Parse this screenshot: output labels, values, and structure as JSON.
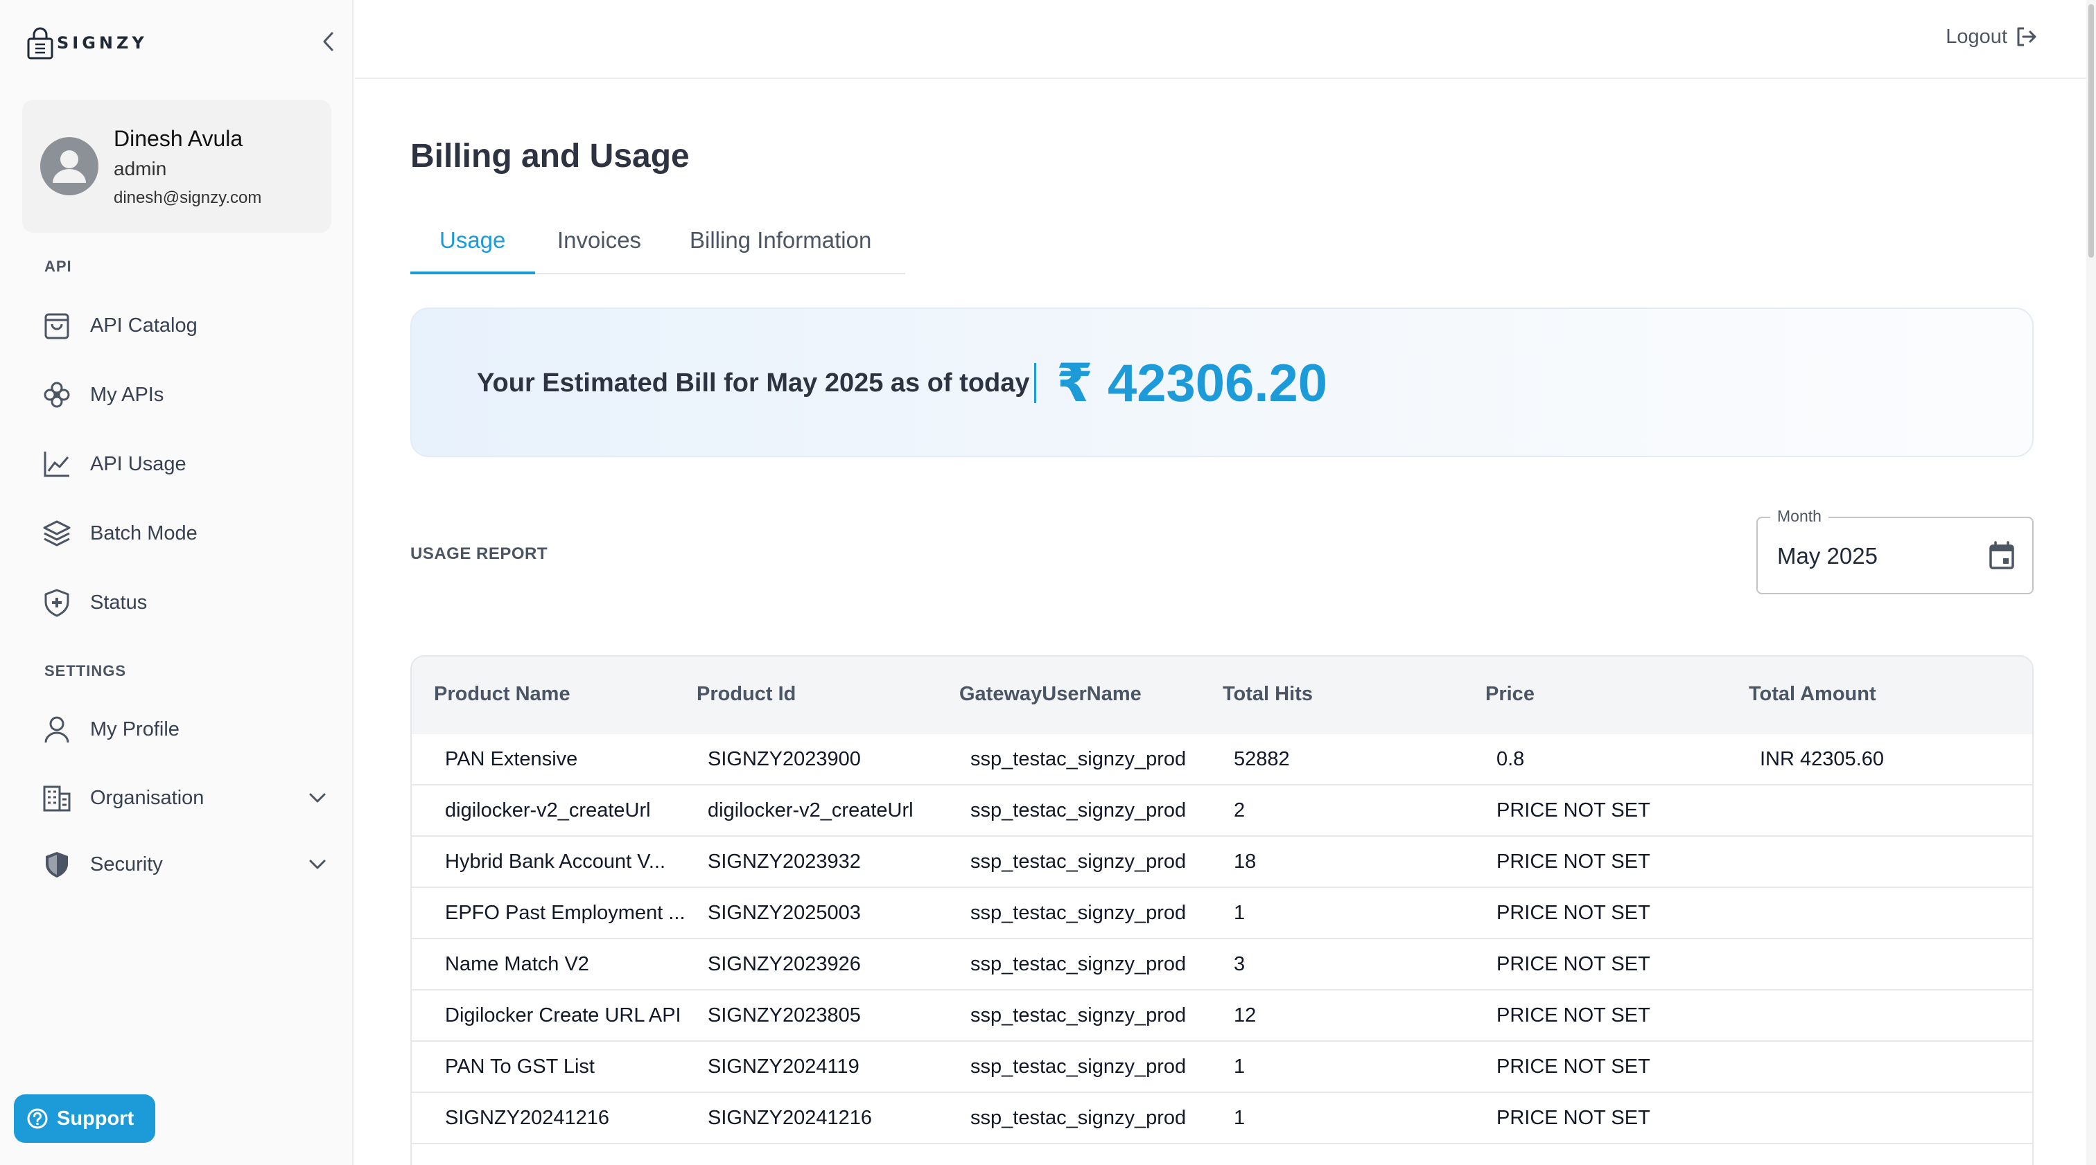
{
  "brand": {
    "logo_text": "SIGNZY"
  },
  "user": {
    "name": "Dinesh Avula",
    "role": "admin",
    "email": "dinesh@signzy.com"
  },
  "sidebar": {
    "api_section_label": "API",
    "api_items": [
      {
        "label": "API Catalog",
        "icon": "shopping-bag-icon"
      },
      {
        "label": "My APIs",
        "icon": "api-nodes-icon"
      },
      {
        "label": "API Usage",
        "icon": "line-chart-icon"
      },
      {
        "label": "Batch Mode",
        "icon": "layers-icon"
      },
      {
        "label": "Status",
        "icon": "shield-plus-icon"
      }
    ],
    "settings_section_label": "SETTINGS",
    "settings_items": [
      {
        "label": "My Profile",
        "icon": "user-icon"
      },
      {
        "label": "Organisation",
        "icon": "building-icon"
      },
      {
        "label": "Security",
        "icon": "shield-icon"
      }
    ],
    "support_label": "Support"
  },
  "topbar": {
    "logout_label": "Logout"
  },
  "main": {
    "title": "Billing and Usage",
    "tabs": [
      {
        "label": "Usage",
        "active": true
      },
      {
        "label": "Invoices",
        "active": false
      },
      {
        "label": "Billing Information",
        "active": false
      }
    ],
    "bill": {
      "text": "Your Estimated Bill for May 2025 as of today",
      "amount": "₹ 42306.20"
    },
    "usage_report_label": "USAGE REPORT",
    "month_picker": {
      "label": "Month",
      "value": "May 2025"
    }
  },
  "table": {
    "headers": [
      "Product Name",
      "Product Id",
      "GatewayUserName",
      "Total Hits",
      "Price",
      "Total Amount"
    ],
    "rows": [
      [
        "PAN Extensive",
        "SIGNZY2023900",
        "ssp_testac_signzy_prod",
        "52882",
        "0.8",
        "INR 42305.60"
      ],
      [
        "digilocker-v2_createUrl",
        "digilocker-v2_createUrl",
        "ssp_testac_signzy_prod",
        "2",
        "PRICE NOT SET",
        ""
      ],
      [
        "Hybrid Bank Account V...",
        "SIGNZY2023932",
        "ssp_testac_signzy_prod",
        "18",
        "PRICE NOT SET",
        ""
      ],
      [
        "EPFO Past Employment ...",
        "SIGNZY2025003",
        "ssp_testac_signzy_prod",
        "1",
        "PRICE NOT SET",
        ""
      ],
      [
        "Name Match V2",
        "SIGNZY2023926",
        "ssp_testac_signzy_prod",
        "3",
        "PRICE NOT SET",
        ""
      ],
      [
        "Digilocker Create URL API",
        "SIGNZY2023805",
        "ssp_testac_signzy_prod",
        "12",
        "PRICE NOT SET",
        ""
      ],
      [
        "PAN To GST List",
        "SIGNZY2024119",
        "ssp_testac_signzy_prod",
        "1",
        "PRICE NOT SET",
        ""
      ],
      [
        "SIGNZY20241216",
        "SIGNZY20241216",
        "ssp_testac_signzy_prod",
        "1",
        "PRICE NOT SET",
        ""
      ]
    ]
  }
}
